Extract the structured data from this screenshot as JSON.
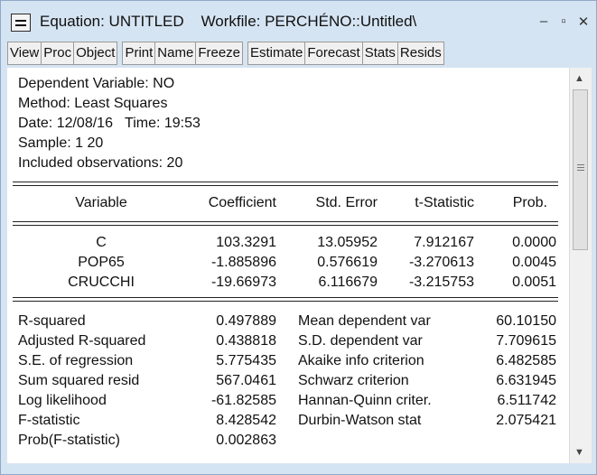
{
  "window": {
    "title": "Equation: UNTITLED    Workfile: PERCHÉNO::Untitled\\",
    "minimize_glyph": "–",
    "restore_glyph": "▫",
    "close_glyph": "✕"
  },
  "toolbar": {
    "groups": [
      [
        "View",
        "Proc",
        "Object"
      ],
      [
        "Print",
        "Name",
        "Freeze"
      ],
      [
        "Estimate",
        "Forecast",
        "Stats",
        "Resids"
      ]
    ]
  },
  "header": {
    "dependent": "Dependent Variable: NO",
    "method": "Method: Least Squares",
    "date": "Date: 12/08/16   Time: 19:53",
    "sample": "Sample: 1 20",
    "obs": "Included observations: 20"
  },
  "coef_table": {
    "columns": [
      "Variable",
      "Coefficient",
      "Std. Error",
      "t-Statistic",
      "Prob."
    ],
    "rows": [
      [
        "C",
        "103.3291",
        "13.05952",
        "7.912167",
        "0.0000"
      ],
      [
        "POP65",
        "-1.885896",
        "0.576619",
        "-3.270613",
        "0.0045"
      ],
      [
        "CRUCCHI",
        "-19.66973",
        "6.116679",
        "-3.215753",
        "0.0051"
      ]
    ]
  },
  "stats": {
    "left": [
      [
        "R-squared",
        "0.497889"
      ],
      [
        "Adjusted R-squared",
        "0.438818"
      ],
      [
        "S.E. of regression",
        "5.775435"
      ],
      [
        "Sum squared resid",
        "567.0461"
      ],
      [
        "Log likelihood",
        "-61.82585"
      ],
      [
        "F-statistic",
        "8.428542"
      ],
      [
        "Prob(F-statistic)",
        "0.002863"
      ]
    ],
    "right": [
      [
        "Mean dependent var",
        "60.10150"
      ],
      [
        "S.D. dependent var",
        "7.709615"
      ],
      [
        "Akaike info criterion",
        "6.482585"
      ],
      [
        "Schwarz criterion",
        "6.631945"
      ],
      [
        "Hannan-Quinn criter.",
        "6.511742"
      ],
      [
        "Durbin-Watson stat",
        "2.075421"
      ]
    ]
  },
  "icons": [
    "window-menu-icon",
    "minimize-icon",
    "restore-icon",
    "close-icon",
    "scroll-up-icon",
    "scroll-down-icon"
  ]
}
